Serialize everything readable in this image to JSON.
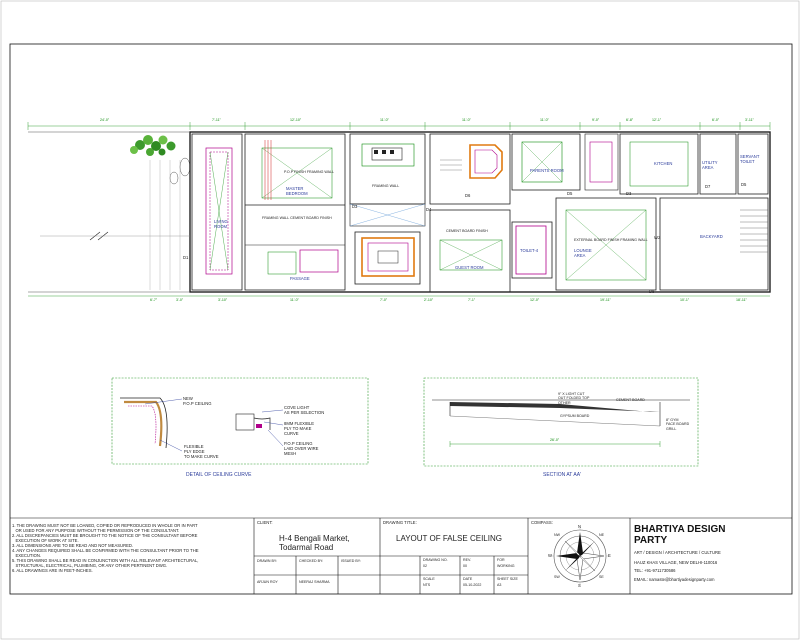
{
  "plan": {
    "rooms": [
      {
        "id": "living",
        "label": "LIVING\nROOM"
      },
      {
        "id": "master",
        "label": "MASTER\nBEDROOM"
      },
      {
        "id": "passage",
        "label": "PASSAGE"
      },
      {
        "id": "guest",
        "label": "GUEST ROOM"
      },
      {
        "id": "parents",
        "label": "PARENTS ROOM"
      },
      {
        "id": "toilet4",
        "label": "TOILET-4"
      },
      {
        "id": "lounge",
        "label": "LOUNGE\nAREA"
      },
      {
        "id": "kitchen",
        "label": "KITCHEN"
      },
      {
        "id": "utility",
        "label": "UTILITY\nAREA"
      },
      {
        "id": "servant",
        "label": "SERVANT\nTOILET"
      },
      {
        "id": "backyard",
        "label": "BACKYARD"
      }
    ],
    "door_tags": [
      "D1",
      "D3",
      "D4",
      "D5",
      "D6",
      "D3",
      "D7",
      "D5",
      "W2",
      "D8"
    ],
    "top_dimensions": [
      "24'-0\"",
      "7'-11\"",
      "12'-10\"",
      "11'-0\"",
      "11'-0\"",
      "11'-0\"",
      "9'-0\"",
      "12'-1\"",
      "6'-0\"",
      "3'-11\"",
      "6'-8\""
    ],
    "bottom_dimensions": [
      "6'-7\"",
      "3'-0\"",
      "3'-10\"",
      "11'-0\"",
      "7'-0\"",
      "2'-10\"",
      "7'-1\"",
      "12'-0\"",
      "19'-11\"",
      "10'-1\"",
      "18'-11\""
    ],
    "ceiling_notes": [
      "P.O.P FINISH FRAMING WALL",
      "FRAMING WALL",
      "FRAMING WALL CEMENT BOARD FINISH",
      "CEMENT BOARD FINISH",
      "EXTERNAL BOARD FINISH FRAMING WALL"
    ]
  },
  "detail_curve": {
    "title": "DETAIL OF CEILING CURVE",
    "callout_pop": "NEW\nP.O.P CEILING",
    "callout_ply": "FLEXIBLE\nPLY EDGE\nTO MAKE CURVE",
    "callout_cove": "COVE LIGHT\nAS PER SELECTION",
    "callout_8mm": "8MM FLEXIBLE\nPLY TO MAKE\nCURVE",
    "callout_wire": "P.O.P CEILING\nLAID OVER WIRE\nMESH"
  },
  "section_aa": {
    "title": "SECTION AT AA'",
    "notes": [
      "9\" X LIGHT CUT\nOUT FOLDED TOP\nOTHER",
      "CEMENT BOARD",
      "GYPSUM BOARD",
      "8\" GYM\nFACE BOARD\nGRILL"
    ],
    "dimension": "26'-0\""
  },
  "notes": [
    "1. THE DRAWING MUST NOT BE LOANED, COPIED OR REPRODUCED IN WHOLE OR IN PART",
    "   OR USED FOR ANY PURPOSE WITHOUT THE PERMISSION OF THE CONSULTANT.",
    "2. ALL DISCREPANCIES MUST BE BROUGHT TO THE NOTICE OF THE CONSULTANT BEFORE",
    "   EXECUTION OF WORK AT SITE.",
    "3. ALL DIMENSIONS ARE TO BE READ AND NOT MEASURED.",
    "4. ANY CHANGES REQUIRED SHALL BE CONFIRMED WITH THE CONSULTANT PRIOR TO THE",
    "   EXECUTION.",
    "5. THIS DRAWING SHALL BE READ IN CONJUNCTION WITH ALL RELEVANT ARCHITECTURAL,",
    "   STRUCTURAL, ELECTRICAL, PLUMBING, OR ANY OTHER PERTINENT DWG.",
    "6. ALL DRAWINGS ARE IN FEET-INCHES."
  ],
  "titleblock": {
    "client_label": "CLIENT:",
    "client_name": "H-4 Bengali Market,\nTodarmal Road",
    "drawing_title_label": "DRAWING TITLE:",
    "drawing_title": "LAYOUT OF FALSE CEILING",
    "compass_label": "COMPASS:",
    "compass_letters": {
      "n": "N",
      "e": "E",
      "s": "S",
      "w": "W",
      "ne": "NE",
      "nw": "NW",
      "se": "SE",
      "sw": "SW"
    },
    "firm_name": "BHARTIYA DESIGN\nPARTY",
    "firm_tagline": "ART / DESIGN / ARCHITECTURE / CULTURE",
    "firm_address": "HAUZ KHAS VILLAGE, NEW DELHI-110016",
    "firm_tel": "TEL: +91-9711730586",
    "firm_email": "EMAIL: namaste@bhartiyadesignparty.com",
    "row1": [
      "DRAWN BY:",
      "CHECKED BY:",
      "ISSUED BY:"
    ],
    "row2": [
      "ARJUN ROY",
      "NEERAJ SHARMA"
    ],
    "meta_labels": [
      "DRAWING NO.",
      "REV.",
      "FOR",
      "SCALE",
      "DATE",
      "SHEET SIZE"
    ],
    "meta_values": [
      "02",
      "00",
      "WORKING",
      "NTS",
      "05-10-2022",
      "A3"
    ]
  }
}
